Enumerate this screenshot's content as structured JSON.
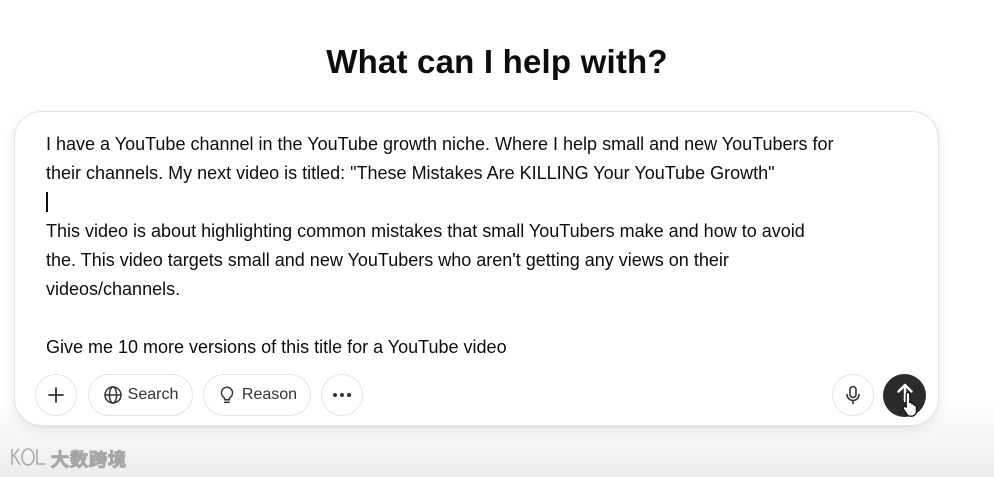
{
  "heading": "What can I help with?",
  "prompt": {
    "lines": [
      "I have a YouTube channel in the YouTube growth niche. Where I help small and new YouTubers for",
      "their channels. My next video is titled: \"These Mistakes Are KILLING Your YouTube Growth\"",
      "",
      "This video is about highlighting common mistakes that small YouTubers make and how to avoid",
      "the. This video targets small and new YouTubers who aren't getting any views on their",
      "videos/channels.",
      "",
      "Give me 10 more versions of this title for a YouTube video"
    ]
  },
  "toolbar": {
    "plus_icon": "plus-icon",
    "search_label": "Search",
    "search_icon": "globe-icon",
    "reason_label": "Reason",
    "reason_icon": "lightbulb-icon",
    "more_icon": "ellipsis-icon",
    "mic_icon": "microphone-icon",
    "send_icon": "arrow-up-icon"
  },
  "watermark": {
    "logo_text": "KOL",
    "text": "大数跨境"
  },
  "colors": {
    "text": "#0d0d0d",
    "send_button": "#2b2b2b",
    "border": "#e3e3e3"
  }
}
